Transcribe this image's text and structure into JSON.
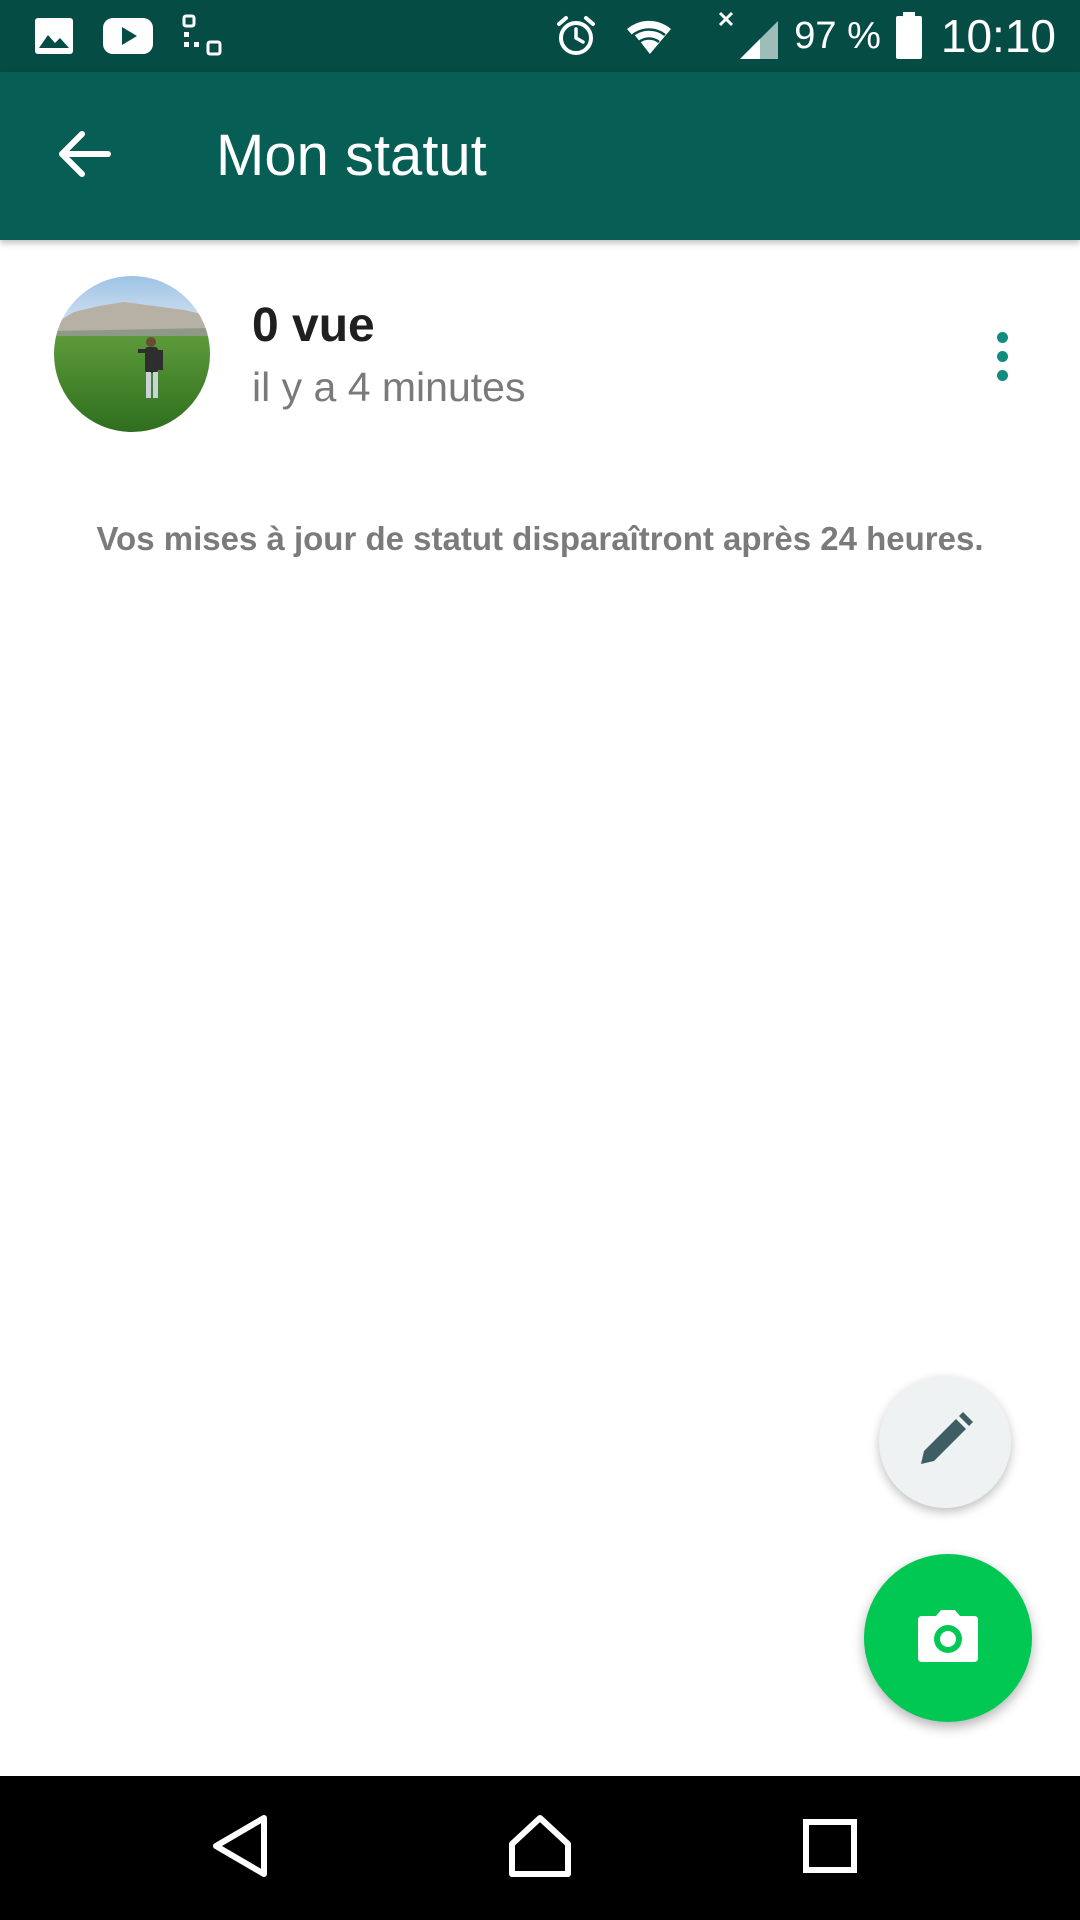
{
  "status_bar": {
    "left_icons": [
      "gallery-icon",
      "youtube-icon",
      "qr-scan-icon"
    ],
    "right_icons": [
      "alarm-icon",
      "wifi-icon",
      "signal-icon",
      "battery-icon"
    ],
    "battery_percent": "97 %",
    "time": "10:10"
  },
  "app_bar": {
    "back_icon": "arrow-left-icon",
    "title": "Mon statut",
    "color": "#075e54"
  },
  "status_item": {
    "views": "0 vue",
    "time_ago": "il y a 4 minutes",
    "menu_icon": "more-vertical-icon"
  },
  "info": {
    "text": "Vos mises à jour de statut disparaîtront après 24 heures."
  },
  "fabs": {
    "edit_icon": "pencil-icon",
    "camera_icon": "camera-icon",
    "camera_color": "#00c853"
  },
  "nav_bar": {
    "buttons": [
      "back-triangle-icon",
      "home-icon",
      "recents-square-icon"
    ]
  }
}
